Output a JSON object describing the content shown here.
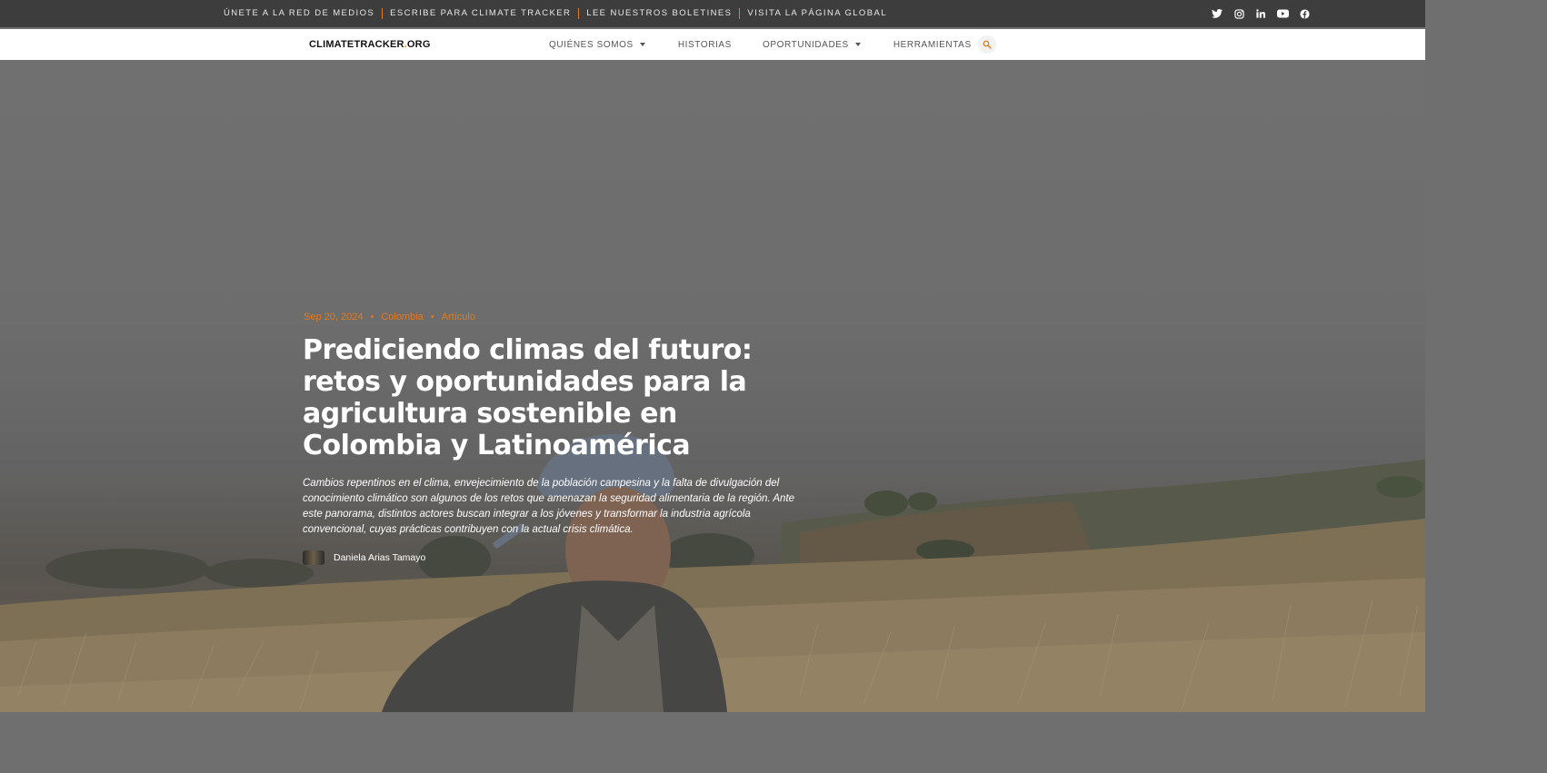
{
  "topbar": {
    "links": [
      "ÚNETE A LA RED DE MEDIOS",
      "ESCRIBE PARA CLIMATE TRACKER",
      "LEE NUESTROS BOLETINES",
      "VISITA LA PÁGINA GLOBAL"
    ],
    "socials": [
      "twitter-icon",
      "instagram-icon",
      "linkedin-icon",
      "youtube-icon",
      "facebook-icon"
    ]
  },
  "nav": {
    "logo_main": "CLIMATETRACKER",
    "logo_dot": ".",
    "logo_tld": "ORG",
    "items": [
      "QUIÉNES SOMOS",
      "HISTORIAS",
      "OPORTUNIDADES",
      "HERRAMIENTAS"
    ]
  },
  "article": {
    "date": "Sep 20, 2024",
    "country": "Colombia",
    "type": "Artículo",
    "separator": "•",
    "title": "Prediciendo climas del futuro: retos y oportunidades para la agricultura sostenible en Colombia y Latinoamérica",
    "summary": "Cambios repentinos en el clima, envejecimiento de la población campesina y la falta de divulgación del conocimiento climático son algunos de los retos que amenazan la seguridad alimentaria de la región. Ante este panorama, distintos actores buscan integrar a los jóvenes y transformar la industria agrícola convencional, cuyas prácticas contribuyen con la actual crisis climática.",
    "author": "Daniela Arias Tamayo"
  },
  "colors": {
    "accent": "#e07a1f",
    "topbar_bg": "#3d3d3d",
    "nav_bg": "#ffffff"
  }
}
